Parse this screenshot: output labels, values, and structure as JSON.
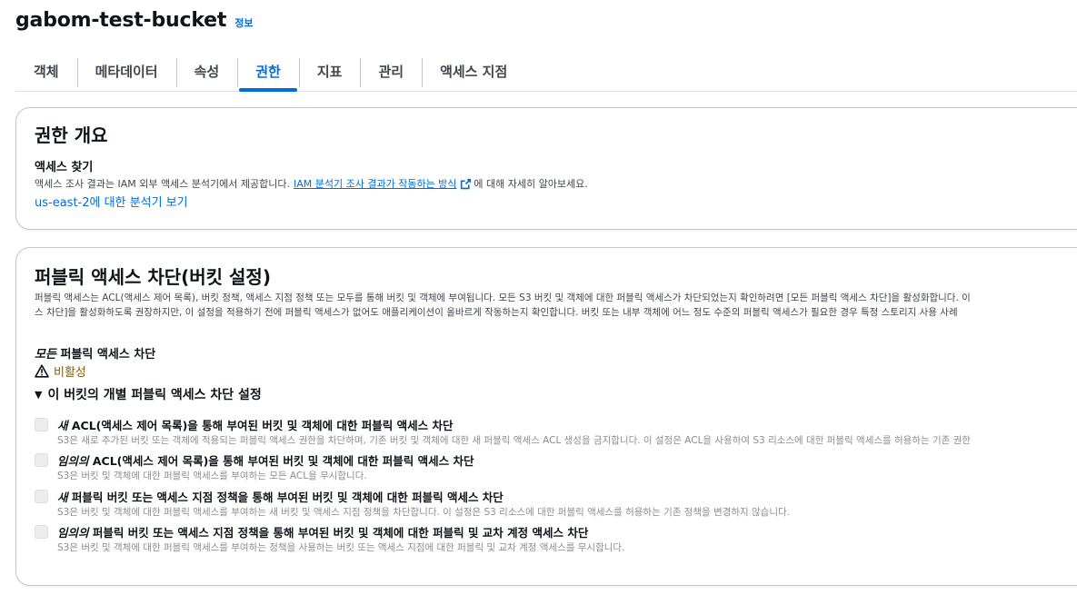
{
  "header": {
    "title": "gabom-test-bucket",
    "info_link": "정보"
  },
  "tabs": [
    {
      "label": "객체",
      "active": false
    },
    {
      "label": "메타데이터",
      "active": false
    },
    {
      "label": "속성",
      "active": false
    },
    {
      "label": "권한",
      "active": true
    },
    {
      "label": "지표",
      "active": false
    },
    {
      "label": "관리",
      "active": false
    },
    {
      "label": "액세스 지점",
      "active": false
    }
  ],
  "overview": {
    "heading": "권한 개요",
    "subheading": "액세스 찾기",
    "desc_before": "액세스 조사 결과는 IAM 외부 액세스 분석기에서 제공합니다.",
    "desc_link": "IAM 분석기 조사 결과가 작동하는 방식",
    "desc_after": "에 대해 자세히 알아보세요.",
    "analyzer_link": "us-east-2에 대한 분석기 보기"
  },
  "public_access": {
    "heading": "퍼블릭 액세스 차단(버킷 설정)",
    "desc_line1": "퍼블릭 액세스는 ACL(액세스 제어 목록), 버킷 정책, 액세스 지점 정책 또는 모두를 통해 버킷 및 객체에 부여됩니다. 모든 S3 버킷 및 객체에 대한 퍼블릭 액세스가 차단되었는지 확인하려면 [모든 퍼블릭 액세스 차단]을 활성화합니다. 이",
    "desc_line2": "스 차단]을 활성화하도록 권장하지만, 이 설정을 적용하기 전에 퍼블릭 액세스가 없어도 애플리케이션이 올바르게 작동하는지 확인합니다. 버킷 또는 내부 객체에 어느 정도 수준의 퍼블릭 액세스가 필요한 경우 특정 스토리지 사용 사례",
    "block_all_em": "모든",
    "block_all_rest": " 퍼블릭 액세스 차단",
    "status": "비활성",
    "expand_label": "이 버킷의 개별 퍼블릭 액세스 차단 설정",
    "settings": [
      {
        "em": "새",
        "label": " ACL(액세스 제어 목록)을 통해 부여된 버킷 및 객체에 대한 퍼블릭 액세스 차단",
        "desc": "S3은 새로 추가된 버킷 또는 객체에 적용되는 퍼블릭 액세스 권한을 차단하며, 기존 버킷 및 객체에 대한 새 퍼블릭 액세스 ACL 생성을 금지합니다. 이 설정은 ACL을 사용하여 S3 리소스에 대한 퍼블릭 액세스를 허용하는 기존 권한",
        "checked": false
      },
      {
        "em": "임의의",
        "label": " ACL(액세스 제어 목록)을 통해 부여된 버킷 및 객체에 대한 퍼블릭 액세스 차단",
        "desc": "S3은 버킷 및 객체에 대한 퍼블릭 액세스를 부여하는 모든 ACL을 무시합니다.",
        "checked": false
      },
      {
        "em": "새",
        "label": " 퍼블릭 버킷 또는 액세스 지점 정책을 통해 부여된 버킷 및 객체에 대한 퍼블릭 액세스 차단",
        "desc": "S3은 버킷 및 객체에 대한 퍼블릭 액세스를 부여하는 새 버킷 및 액세스 지점 정책을 차단합니다. 이 설정은 S3 리소스에 대한 퍼블릭 액세스를 허용하는 기존 정책을 변경하지 않습니다.",
        "checked": false
      },
      {
        "em": "임의의",
        "label": " 퍼블릭 버킷 또는 액세스 지점 정책을 통해 부여된 버킷 및 객체에 대한 퍼블릭 및 교차 계정 액세스 차단",
        "desc": "S3은 버킷 및 객체에 대한 퍼블릭 액세스를 부여하는 정책을 사용하는 버킷 또는 액세스 지점에 대한 퍼블릭 및 교차 계정 액세스를 무시합니다.",
        "checked": false
      }
    ]
  },
  "colors": {
    "accent": "#006ce0",
    "warning": "#855900",
    "border": "#c6c6cd"
  },
  "icons": [
    "external-link-icon",
    "warning-icon",
    "caret-down-icon"
  ]
}
